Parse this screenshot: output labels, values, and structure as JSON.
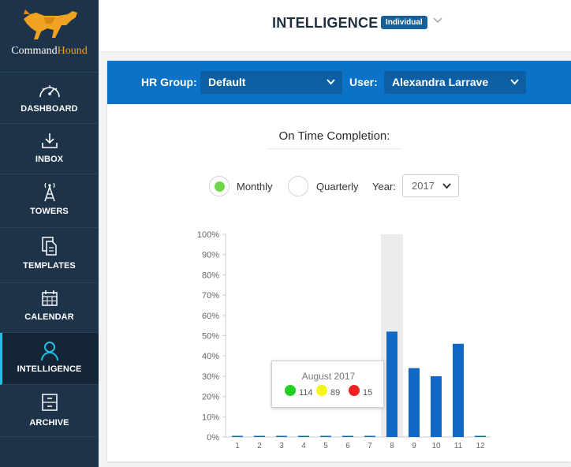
{
  "brand": {
    "name_part1": "Command",
    "name_part2": "Hound"
  },
  "sidebar": {
    "items": [
      {
        "label": "DASHBOARD",
        "icon": "dashboard-gauge-icon",
        "active": false
      },
      {
        "label": "INBOX",
        "icon": "inbox-download-icon",
        "active": false
      },
      {
        "label": "TOWERS",
        "icon": "tower-antenna-icon",
        "active": false
      },
      {
        "label": "TEMPLATES",
        "icon": "templates-documents-icon",
        "active": false
      },
      {
        "label": "CALENDAR",
        "icon": "calendar-icon",
        "active": false
      },
      {
        "label": "INTELLIGENCE",
        "icon": "user-icon",
        "active": true
      },
      {
        "label": "ARCHIVE",
        "icon": "archive-cabinet-icon",
        "active": false
      }
    ]
  },
  "header": {
    "title": "INTELLIGENCE",
    "badge": "Individual"
  },
  "filters": {
    "hr_group_label": "HR Group:",
    "hr_group_value": "Default",
    "user_label": "User:",
    "user_value": "Alexandra Larrave"
  },
  "section_title": "On Time Completion:",
  "period": {
    "monthly_label": "Monthly",
    "quarterly_label": "Quarterly",
    "selected": "Monthly",
    "year_label": "Year:",
    "year_value": "2017"
  },
  "colors": {
    "sidebar_bg": "#1d3349",
    "accent_blue": "#0a73c7",
    "bar_blue": "#1068c4",
    "active_indicator": "#1ec0e6",
    "on_time": "#22d022",
    "late": "#f5f51a",
    "missed": "#f02020"
  },
  "chart_data": {
    "type": "bar",
    "categories": [
      "1",
      "2",
      "3",
      "4",
      "5",
      "6",
      "7",
      "8",
      "9",
      "10",
      "11",
      "12"
    ],
    "values": [
      0,
      0,
      0,
      0,
      0,
      0,
      0,
      52,
      34,
      30,
      46,
      0
    ],
    "ylim": [
      0,
      100
    ],
    "ytick_labels": [
      "0%",
      "10%",
      "20%",
      "30%",
      "40%",
      "50%",
      "60%",
      "70%",
      "80%",
      "90%",
      "100%"
    ],
    "highlighted_category": "8",
    "tooltip": {
      "title": "August 2017",
      "items": [
        {
          "color": "#22d022",
          "value": "114"
        },
        {
          "color": "#f5f51a",
          "value": "89"
        },
        {
          "color": "#f02020",
          "value": "15"
        }
      ]
    }
  }
}
